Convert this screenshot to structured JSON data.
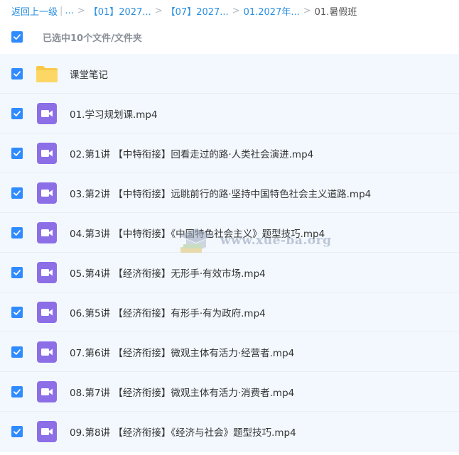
{
  "breadcrumb": {
    "back": "返回上一级",
    "ellipsis": "...",
    "crumbs": [
      "【01】2027...",
      "【07】2027...",
      "01.2027年..."
    ],
    "current": "01.暑假班"
  },
  "selection": {
    "label": "已选中10个文件/文件夹"
  },
  "files": [
    {
      "name": "课堂笔记",
      "type": "folder"
    },
    {
      "name": "01.学习规划课.mp4",
      "type": "video"
    },
    {
      "name": "02.第1讲 【中特衔接】回看走过的路·人类社会演进.mp4",
      "type": "video"
    },
    {
      "name": "03.第2讲 【中特衔接】远眺前行的路·坚持中国特色社会主义道路.mp4",
      "type": "video"
    },
    {
      "name": "04.第3讲 【中特衔接】《中国特色社会主义》题型技巧.mp4",
      "type": "video"
    },
    {
      "name": "05.第4讲 【经济衔接】无形手·有效市场.mp4",
      "type": "video"
    },
    {
      "name": "06.第5讲 【经济衔接】有形手·有为政府.mp4",
      "type": "video"
    },
    {
      "name": "07.第6讲 【经济衔接】微观主体有活力·经营者.mp4",
      "type": "video"
    },
    {
      "name": "08.第7讲 【经济衔接】微观主体有活力·消费者.mp4",
      "type": "video"
    },
    {
      "name": "09.第8讲 【经济衔接】《经济与社会》题型技巧.mp4",
      "type": "video"
    }
  ],
  "watermark": {
    "text": "www.xue-ba.org"
  },
  "colors": {
    "accent": "#2f8bff",
    "link": "#2a8fe0",
    "folder": "#f9c84a",
    "video": "#8c6ee6",
    "row_bg": "#f3f8fe"
  }
}
